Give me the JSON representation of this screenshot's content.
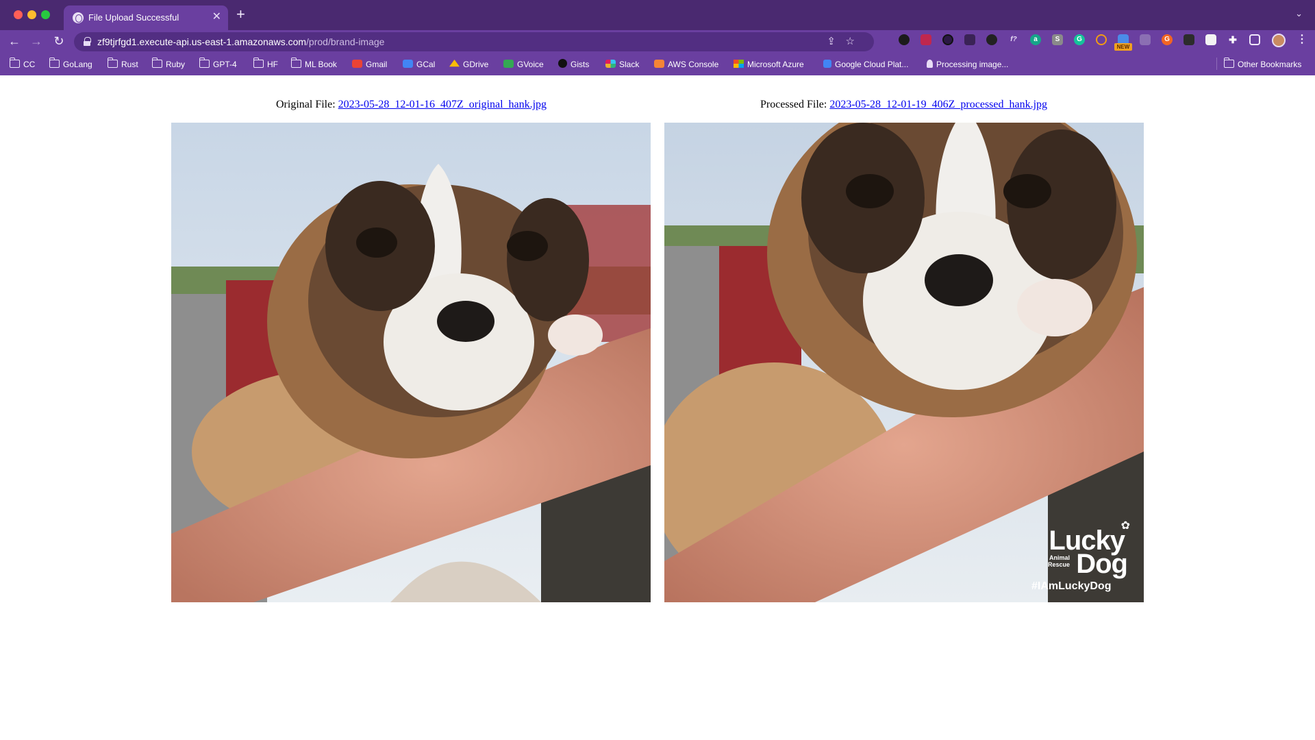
{
  "window": {
    "tab_title": "File Upload Successful",
    "tab_close": "✕",
    "new_tab": "+",
    "tab_menu": "⌄"
  },
  "toolbar": {
    "back": "←",
    "forward": "→",
    "reload": "↻",
    "url_host": "zf9tjrfgd1.execute-api.us-east-1.amazonaws.com",
    "url_path": "/prod/brand-image",
    "share": "⇪",
    "star": "☆",
    "extensions_badge": "NEW",
    "menu": "⋮"
  },
  "bookmarks": [
    {
      "label": "CC",
      "icon": "folder-icon"
    },
    {
      "label": "GoLang",
      "icon": "folder-icon"
    },
    {
      "label": "Rust",
      "icon": "folder-icon"
    },
    {
      "label": "Ruby",
      "icon": "folder-icon"
    },
    {
      "label": "GPT-4",
      "icon": "folder-icon"
    },
    {
      "label": "HF",
      "icon": "folder-icon"
    },
    {
      "label": "ML Book",
      "icon": "folder-icon"
    },
    {
      "label": "Gmail",
      "icon": "gmail-icon"
    },
    {
      "label": "GCal",
      "icon": "gcal-icon"
    },
    {
      "label": "GDrive",
      "icon": "gdrive-icon"
    },
    {
      "label": "GVoice",
      "icon": "gvoice-icon"
    },
    {
      "label": "Gists",
      "icon": "github-icon"
    },
    {
      "label": "Slack",
      "icon": "slack-icon"
    },
    {
      "label": "AWS Console",
      "icon": "aws-icon"
    },
    {
      "label": "Microsoft Azure",
      "icon": "azure-icon"
    },
    {
      "label": "Google Cloud Plat...",
      "icon": "gcp-icon"
    },
    {
      "label": "Processing image...",
      "icon": "rocket-icon"
    }
  ],
  "other_bookmarks": "Other Bookmarks",
  "page": {
    "original_label": "Original File: ",
    "original_link": "2023-05-28_12-01-16_407Z_original_hank.jpg",
    "processed_label": "Processed File: ",
    "processed_link": "2023-05-28_12-01-19_406Z_processed_hank.jpg",
    "watermark": {
      "lucky": "Lucky",
      "animal": "Animal",
      "rescue": "Rescue",
      "dog": "Dog",
      "hashtag": "#IAmLuckyDog"
    }
  }
}
